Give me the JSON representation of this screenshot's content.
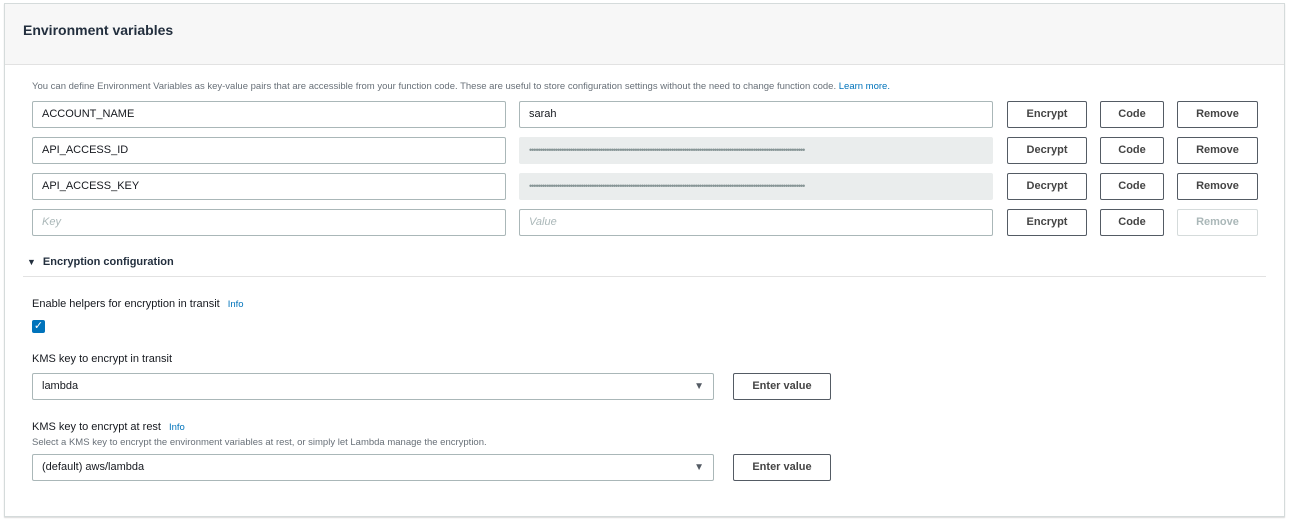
{
  "title": "Environment variables",
  "description": "You can define Environment Variables as key-value pairs that are accessible from your function code. These are useful to store configuration settings without the need to change function code.",
  "learn_more": "Learn more.",
  "rows": [
    {
      "key": "ACCOUNT_NAME",
      "value": "sarah",
      "action": "Encrypt",
      "code": "Code",
      "remove": "Remove"
    },
    {
      "key": "API_ACCESS_ID",
      "value": "••••••••••••••••••••••••••••••••••••••••••••••••••••••••••••••••••••••••••••••••••••••••••••••••••••••••••••••••••••••••••••••••",
      "action": "Decrypt",
      "code": "Code",
      "remove": "Remove"
    },
    {
      "key": "API_ACCESS_KEY",
      "value": "••••••••••••••••••••••••••••••••••••••••••••••••••••••••••••••••••••••••••••••••••••••••••••••••••••••••••••••••••••••••••••••••",
      "action": "Decrypt",
      "code": "Code",
      "remove": "Remove"
    },
    {
      "key_placeholder": "Key",
      "value_placeholder": "Value",
      "action": "Encrypt",
      "code": "Code",
      "remove": "Remove"
    }
  ],
  "encryption": {
    "section_label": "Encryption configuration",
    "helpers_label": "Enable helpers for encryption in transit",
    "info": "Info",
    "helpers_checked": true,
    "transit_label": "KMS key to encrypt in transit",
    "transit_value": "lambda",
    "enter_value": "Enter value",
    "rest_label": "KMS key to encrypt at rest",
    "rest_help": "Select a KMS key to encrypt the environment variables at rest, or simply let Lambda manage the encryption.",
    "rest_value": "(default) aws/lambda"
  }
}
